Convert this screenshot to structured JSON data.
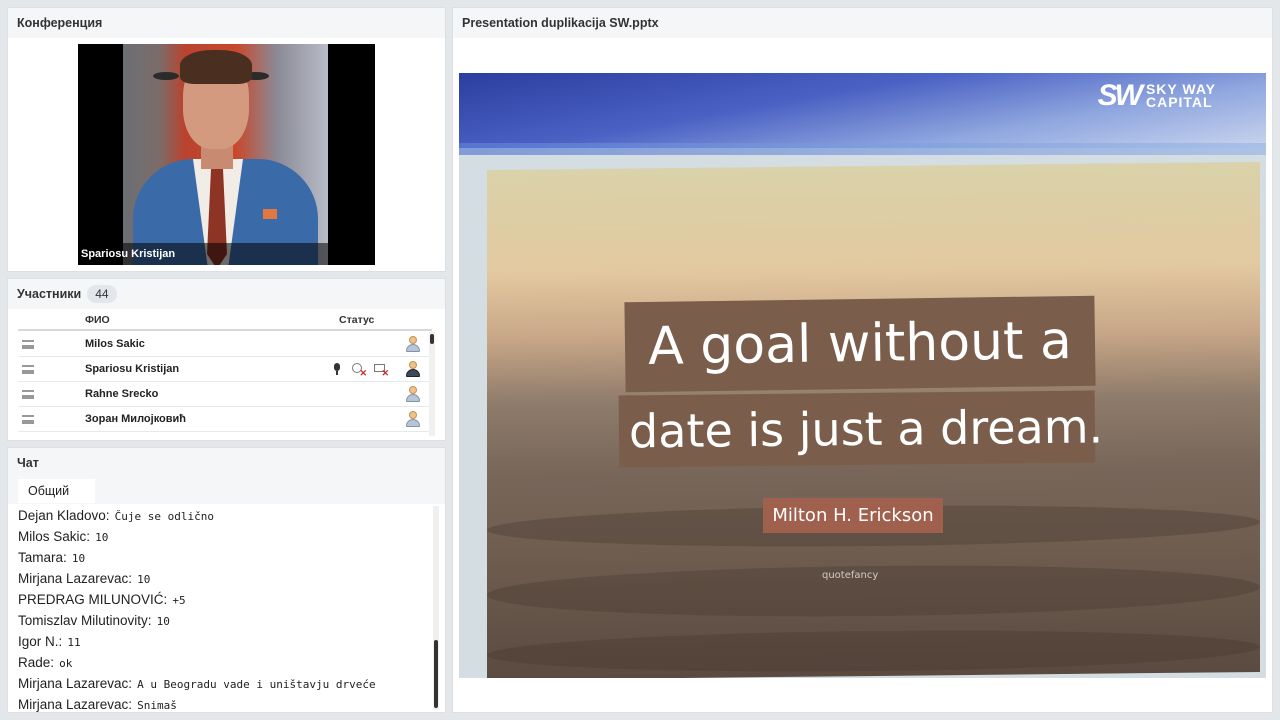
{
  "conference": {
    "title": "Конференция",
    "speaker_name": "Spariosu Kristijan"
  },
  "participants": {
    "title": "Участники",
    "count": "44",
    "columns": {
      "name": "ФИО",
      "status": "Статус"
    },
    "rows": [
      {
        "name": "Milos Sakic",
        "active": false
      },
      {
        "name": "Spariosu Kristijan",
        "active": true
      },
      {
        "name": "Rahne Srecko",
        "active": false
      },
      {
        "name": "Зоран Милојковић",
        "active": false
      }
    ]
  },
  "chat": {
    "title": "Чат",
    "tab": "Общий",
    "messages": [
      {
        "author": "Dejan Kladovo:",
        "text": "Čuje se odlično"
      },
      {
        "author": "Milos Sakic:",
        "text": "10"
      },
      {
        "author": "Tamara:",
        "text": "10"
      },
      {
        "author": "Mirjana Lazarevac:",
        "text": "10"
      },
      {
        "author": "PREDRAG MILUNOVIĆ:",
        "text": "+5"
      },
      {
        "author": "Tomiszlav Milutinovity:",
        "text": "10"
      },
      {
        "author": "Igor N.:",
        "text": "11"
      },
      {
        "author": "Rade:",
        "text": "ok"
      },
      {
        "author": "Mirjana Lazarevac:",
        "text": "A u Beogradu vade i uništavju drveće"
      },
      {
        "author": "Mirjana Lazarevac:",
        "text": "Snimaš"
      }
    ]
  },
  "presentation": {
    "title": "Presentation duplikacija SW.pptx",
    "logo_mark": "SW",
    "logo_line1": "SKY WAY",
    "logo_line2": "CAPITAL",
    "quote_line1": "A goal without a",
    "quote_line2": "date is just a dream.",
    "quote_author": "Milton H. Erickson",
    "watermark": "quotefancy"
  },
  "icons": {
    "drag": "drag-handle-icon",
    "mic": "microphone-icon",
    "camera_off": "camera-off-icon",
    "screen_off": "screen-share-off-icon",
    "user": "user-icon"
  }
}
